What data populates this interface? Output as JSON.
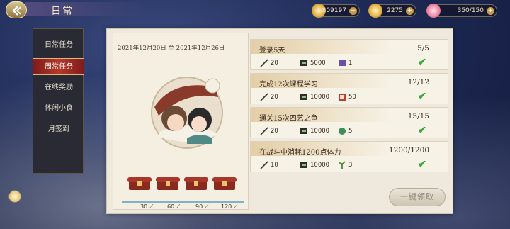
{
  "header": {
    "title": "日常",
    "resources": [
      {
        "icon": "coin-icon",
        "value": "809197"
      },
      {
        "icon": "feather-icon",
        "value": "2275"
      },
      {
        "icon": "peach-blossom-icon",
        "value": "350/150"
      }
    ]
  },
  "sidebar": {
    "items": [
      {
        "label": "日常任务",
        "active": false
      },
      {
        "label": "周常任务",
        "active": true
      },
      {
        "label": "在线奖励",
        "active": false
      },
      {
        "label": "休闲小食",
        "active": false
      },
      {
        "label": "月签到",
        "active": false
      }
    ]
  },
  "weekly": {
    "date_range": "2021年12月20日 至 2021年12月26日",
    "milestones": [
      "30",
      "60",
      "90",
      "120"
    ]
  },
  "tasks": [
    {
      "title": "登录5天",
      "progress": "5/5",
      "done": true,
      "rewards": [
        {
          "icon": "brush-icon",
          "value": "20"
        },
        {
          "icon": "ink-coin-icon",
          "value": "5000"
        },
        {
          "icon": "scroll-icon",
          "value": "1"
        }
      ]
    },
    {
      "title": "完成12次课程学习",
      "progress": "12/12",
      "done": true,
      "rewards": [
        {
          "icon": "brush-icon",
          "value": "20"
        },
        {
          "icon": "ink-coin-icon",
          "value": "10000"
        },
        {
          "icon": "book-icon",
          "value": "50"
        }
      ]
    },
    {
      "title": "通关15次四艺之争",
      "progress": "15/15",
      "done": true,
      "rewards": [
        {
          "icon": "brush-icon",
          "value": "20"
        },
        {
          "icon": "ink-coin-icon",
          "value": "10000"
        },
        {
          "icon": "jade-icon",
          "value": "5"
        }
      ]
    },
    {
      "title": "在战斗中消耗1200点体力",
      "progress": "1200/1200",
      "done": true,
      "rewards": [
        {
          "icon": "brush-icon",
          "value": "10"
        },
        {
          "icon": "ink-coin-icon",
          "value": "10000"
        },
        {
          "icon": "herb-icon",
          "value": "3"
        }
      ]
    }
  ],
  "claim_all_label": "一键领取",
  "colors": {
    "active_tab": "#b23a2a",
    "check": "#38a83a",
    "panel": "#efe9dd"
  }
}
